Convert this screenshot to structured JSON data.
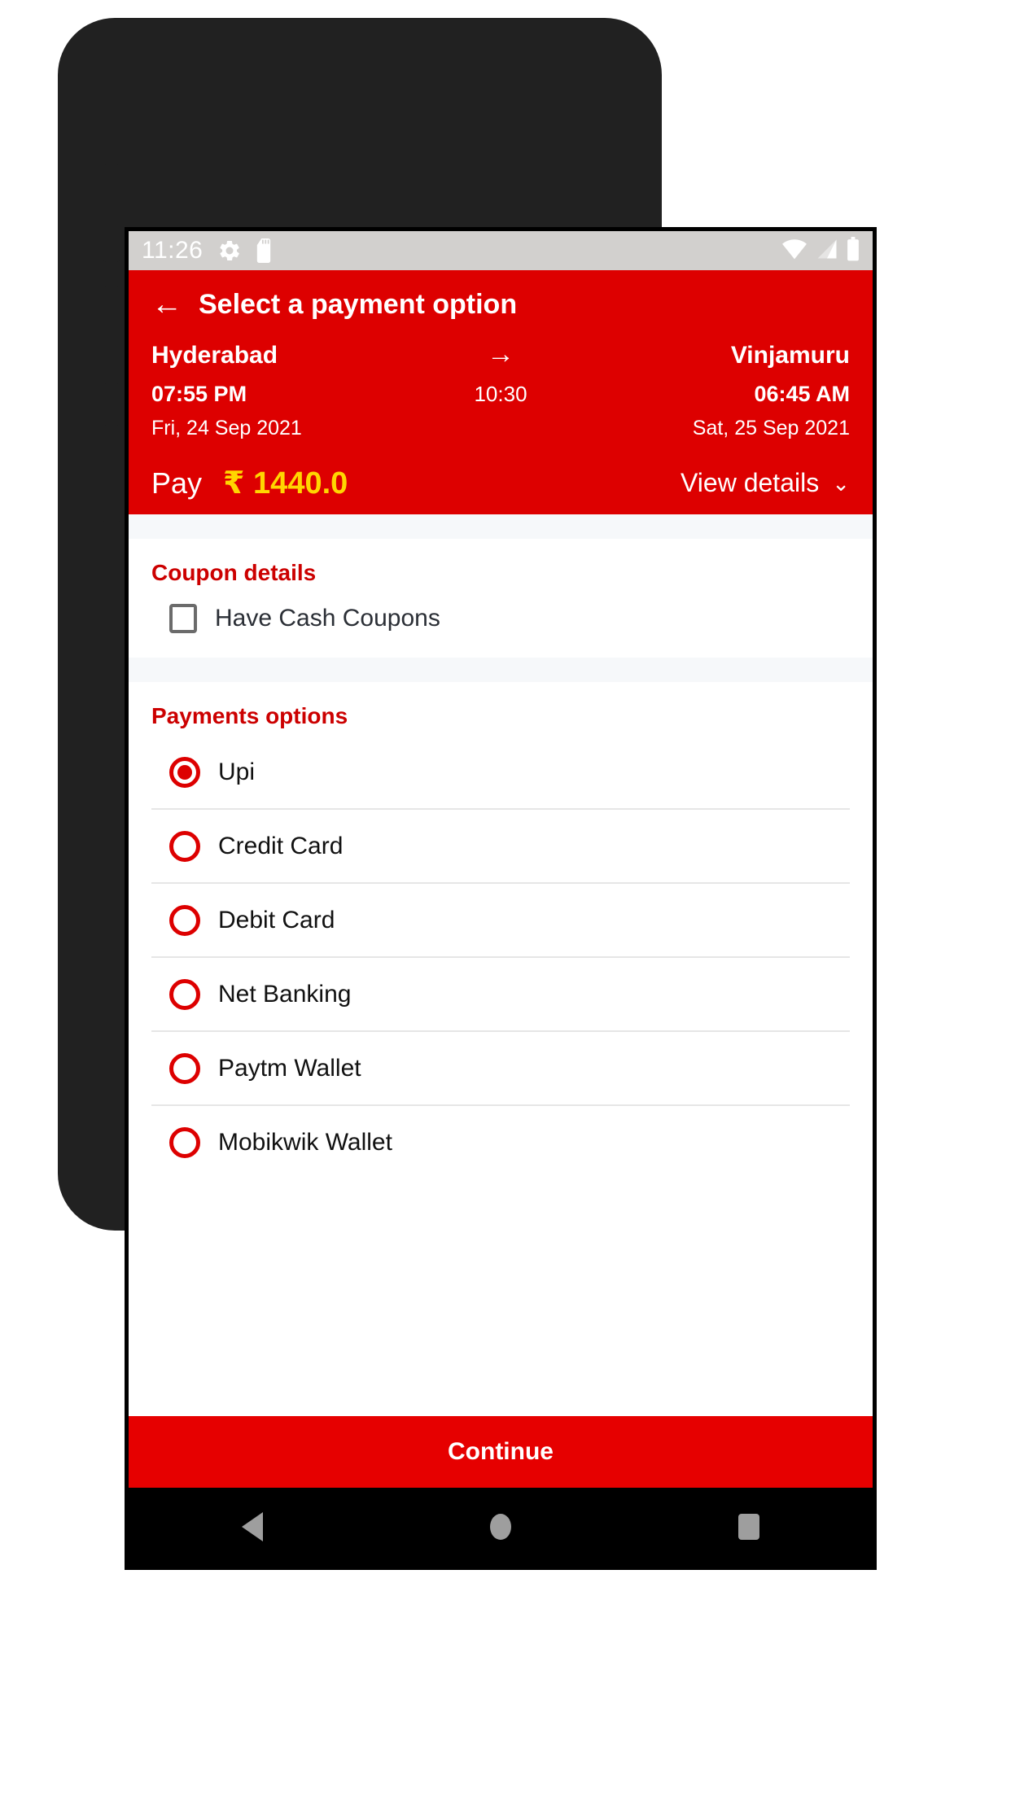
{
  "status_bar": {
    "time": "11:26",
    "left_icons": [
      "gear-icon",
      "sd-card-icon"
    ],
    "right_icons": [
      "wifi-icon",
      "signal-icon",
      "battery-icon"
    ]
  },
  "toolbar": {
    "back_icon": "←",
    "title": "Select a payment option"
  },
  "journey": {
    "from_place": "Hyderabad",
    "to_place": "Vinjamuru",
    "mid_arrow": "→",
    "from_time": "07:55 PM",
    "duration": "10:30",
    "to_time": "06:45 AM",
    "from_date": "Fri, 24 Sep 2021",
    "to_date": "Sat, 25 Sep 2021"
  },
  "fare": {
    "pay_label": "Pay",
    "amount": "₹ 1440.0",
    "view_details_label": "View details",
    "chevron": "⌄"
  },
  "coupon": {
    "section_title": "Coupon details",
    "checkbox_label": "Have Cash Coupons",
    "checked": false
  },
  "payments": {
    "section_title": "Payments options",
    "options": [
      {
        "label": "Upi",
        "selected": true
      },
      {
        "label": "Credit Card",
        "selected": false
      },
      {
        "label": "Debit Card",
        "selected": false
      },
      {
        "label": "Net Banking",
        "selected": false
      },
      {
        "label": "Paytm Wallet",
        "selected": false
      },
      {
        "label": "Mobikwik Wallet",
        "selected": false
      }
    ]
  },
  "footer": {
    "continue_label": "Continue"
  },
  "nav_bar": {
    "back_icon": "nav-back-icon",
    "home_icon": "nav-home-icon",
    "recents_icon": "nav-recents-icon"
  },
  "colors": {
    "brand_red": "#dd0000",
    "accent_yellow": "#ffd600",
    "status_bar_gray": "#d2d0ce",
    "section_gap": "#f6f8fa"
  }
}
